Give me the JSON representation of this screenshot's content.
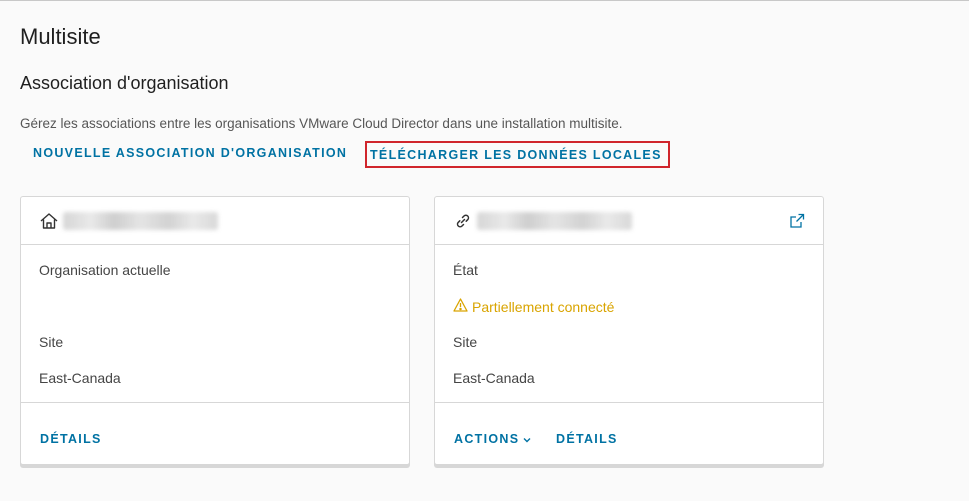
{
  "page": {
    "title": "Multisite"
  },
  "section": {
    "title": "Association d'organisation",
    "description": "Gérez les associations entre les organisations VMware Cloud Director dans une installation multisite."
  },
  "toolbar": {
    "new_association_label": "NOUVELLE ASSOCIATION D'ORGANISATION",
    "download_local_data_label": "TÉLÉCHARGER LES DONNÉES LOCALES"
  },
  "cards": [
    {
      "icon": "home-icon",
      "name_redacted": true,
      "fields": [
        {
          "label": "Organisation actuelle",
          "value": ""
        },
        {
          "label": "Site",
          "value": "East-Canada"
        }
      ],
      "footer": {
        "details_label": "DÉTAILS"
      }
    },
    {
      "icon": "link-icon",
      "name_redacted": true,
      "external_icon": "external-link-icon",
      "fields": [
        {
          "label": "État",
          "value": "Partiellement connecté",
          "status_icon": "warning-icon",
          "status_color": "#d9a400"
        },
        {
          "label": "Site",
          "value": "East-Canada"
        }
      ],
      "footer": {
        "actions_label": "ACTIONS",
        "details_label": "DÉTAILS"
      }
    }
  ],
  "colors": {
    "link": "#0072a3",
    "highlight_border": "#d0252c",
    "warning": "#d9a400"
  }
}
